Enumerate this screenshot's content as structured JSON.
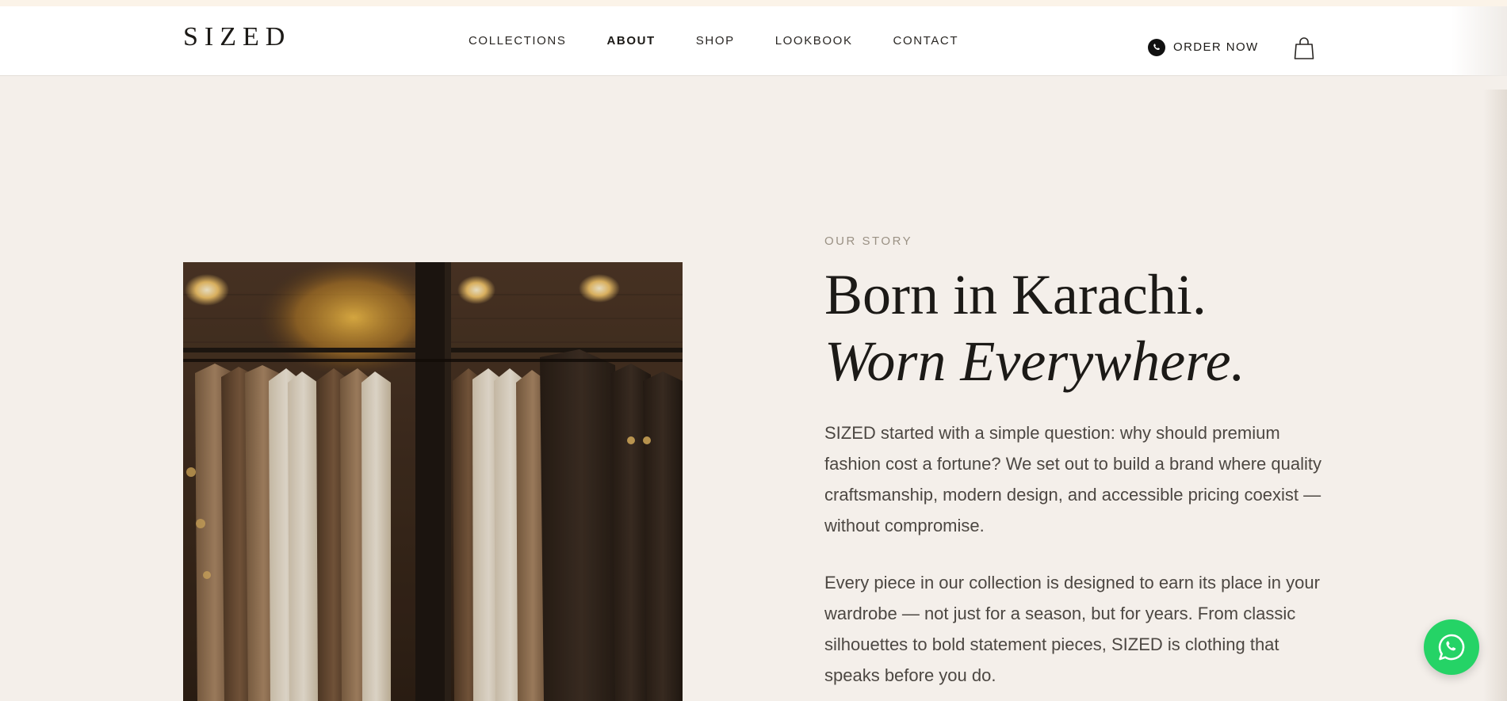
{
  "header": {
    "logo": "SIZED",
    "nav": [
      {
        "label": "COLLECTIONS",
        "active": false
      },
      {
        "label": "ABOUT",
        "active": true
      },
      {
        "label": "SHOP",
        "active": false
      },
      {
        "label": "LOOKBOOK",
        "active": false
      },
      {
        "label": "CONTACT",
        "active": false
      }
    ],
    "order_label": "ORDER NOW",
    "order_icon": "whatsapp-icon",
    "cart_icon": "shopping-bag-icon"
  },
  "story": {
    "eyebrow": "OUR STORY",
    "headline_line1": "Born in Karachi.",
    "headline_line2": "Worn Everywhere.",
    "paragraph1": "SIZED started with a simple question: why should premium fashion cost a fortune? We set out to build a brand where quality craftsmanship, modern design, and accessible pricing coexist — without compromise.",
    "paragraph2": "Every piece in our collection is designed to earn its place in your wardrobe — not just for a season, but for years. From classic silhouettes to bold statement pieces, SIZED is clothing that speaks before you do."
  },
  "floating_button_icon": "whatsapp-icon",
  "colors": {
    "page_bg": "#f4efea",
    "header_bg": "#ffffff",
    "eyebrow": "#9a9184",
    "body_text": "#4c4742",
    "whatsapp_green": "#25d366"
  }
}
